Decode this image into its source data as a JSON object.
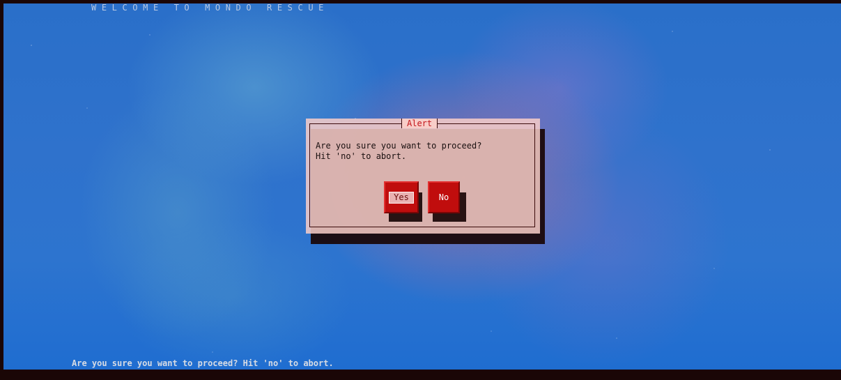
{
  "header": {
    "title": "WELCOME TO MONDO RESCUE"
  },
  "dialog": {
    "title": "Alert",
    "message_line1": "Are you sure you want to proceed?",
    "message_line2": "Hit 'no' to abort.",
    "buttons": {
      "yes_label": "Yes",
      "no_label": "No",
      "focused": "Yes"
    }
  },
  "status_bar": {
    "text": "Are you sure you want to proceed? Hit 'no' to abort."
  },
  "colors": {
    "dialog_bg": "#f8cdc8",
    "button_bg": "#c00d0d",
    "title_text": "#c4161c",
    "desktop_blue": "#2d74cf"
  }
}
